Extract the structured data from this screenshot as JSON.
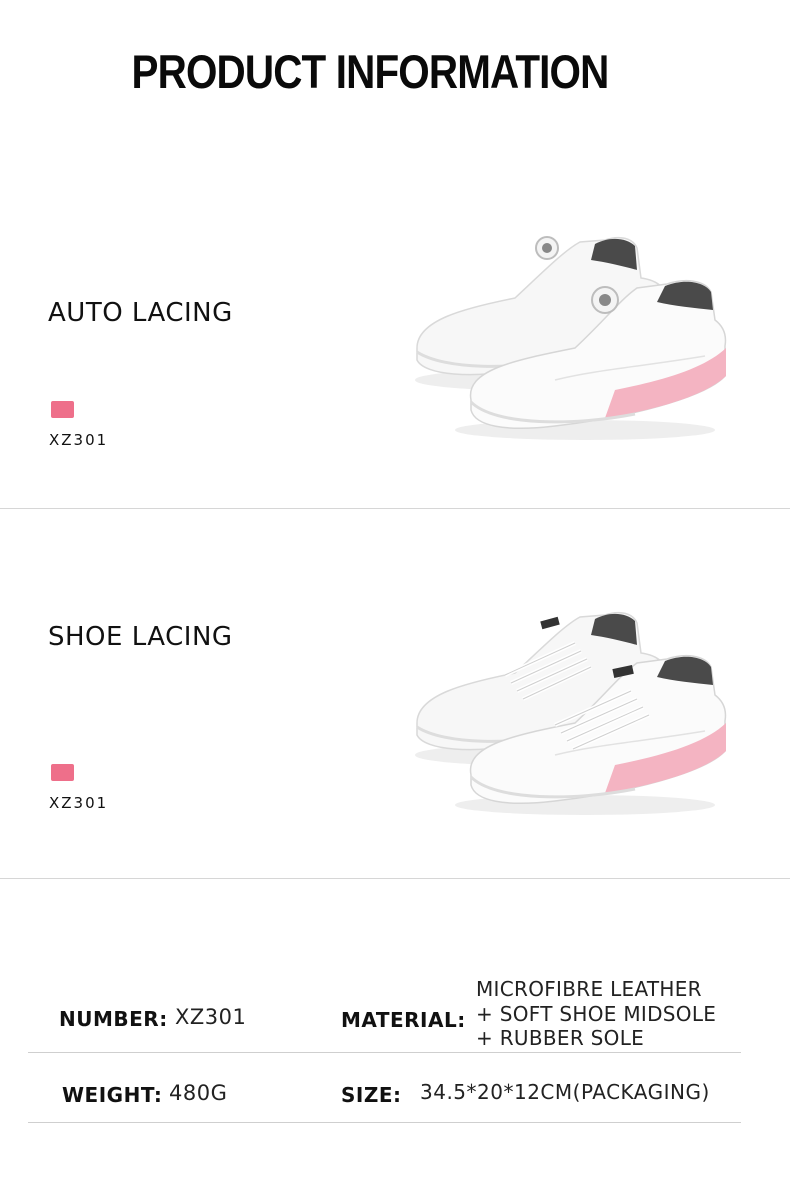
{
  "header": {
    "title": "PRODUCT INFORMATION"
  },
  "sections": [
    {
      "feature": "AUTO LACING",
      "color_hex": "#ee6f8a",
      "model": "XZ301",
      "image_icon": "white-golf-shoes-boa-dial-icon"
    },
    {
      "feature": "SHOE LACING",
      "color_hex": "#ee6f8a",
      "model": "XZ301",
      "image_icon": "white-golf-shoes-laces-icon"
    }
  ],
  "specs": {
    "number_label": "NUMBER:",
    "number_value": "XZ301",
    "material_label": "MATERIAL:",
    "material_lines": [
      "MICROFIBRE LEATHER",
      "+ SOFT SHOE MIDSOLE",
      "+ RUBBER SOLE"
    ],
    "weight_label": "WEIGHT:",
    "weight_value": "480G",
    "size_label": "SIZE:",
    "size_value": "34.5*20*12CM(PACKAGING)"
  }
}
